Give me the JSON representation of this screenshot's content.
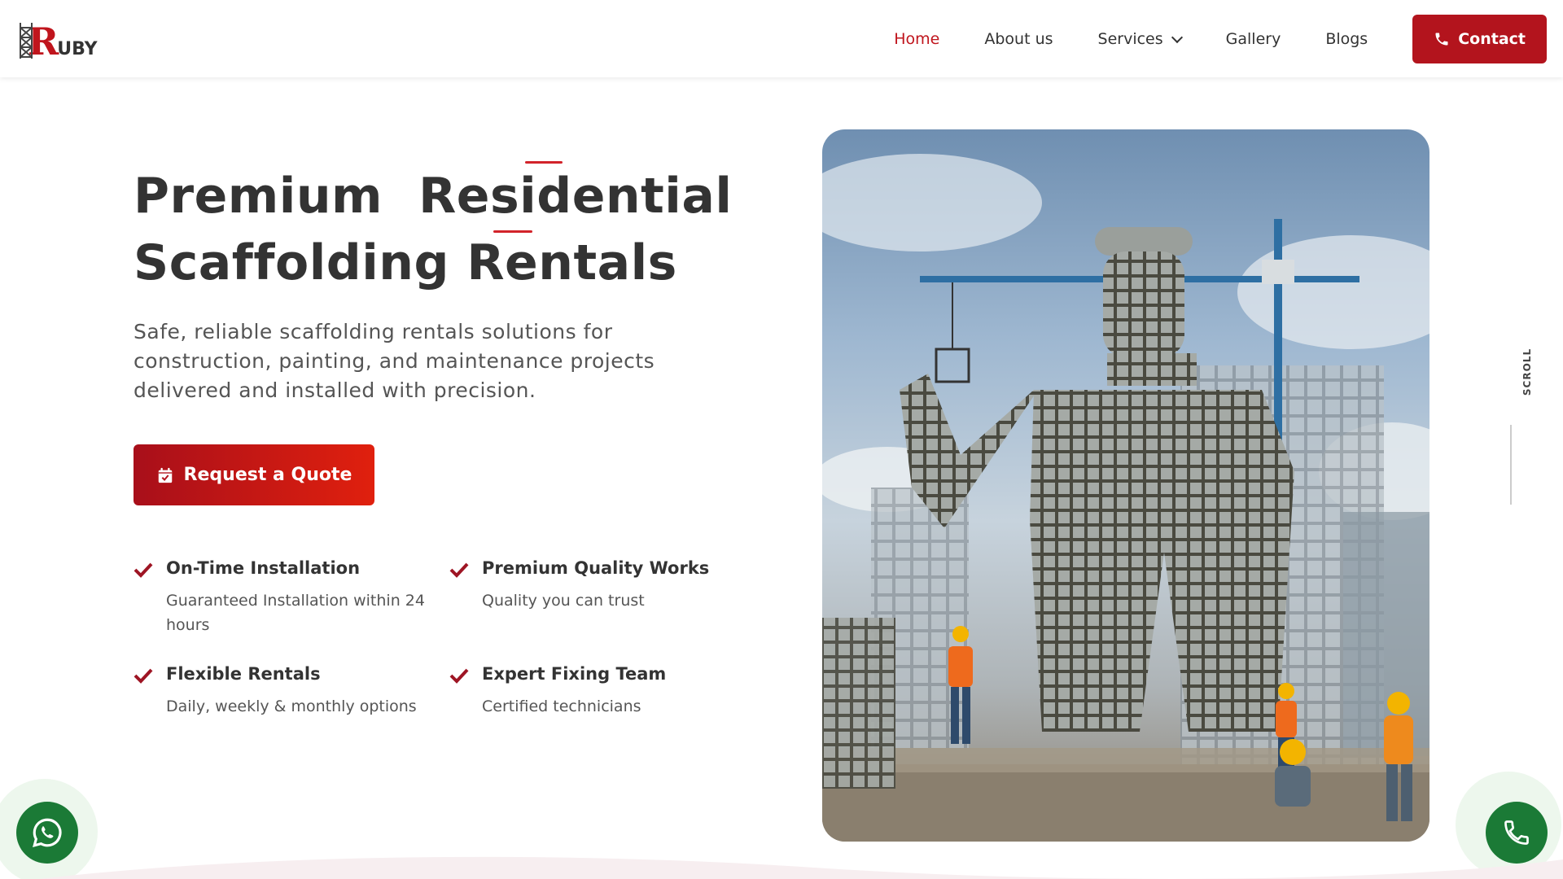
{
  "brand": {
    "logo_text_r": "R",
    "logo_text_rest": "UBY",
    "accent": "#c0151d"
  },
  "nav": {
    "items": [
      {
        "label": "Home",
        "active": true
      },
      {
        "label": "About us"
      },
      {
        "label": "Services",
        "has_dropdown": true
      },
      {
        "label": "Gallery"
      },
      {
        "label": "Blogs"
      }
    ],
    "contact_label": "Contact",
    "contact_icon": "phone-icon"
  },
  "hero": {
    "title_word_1": "Premium",
    "title_word_2": "Residential",
    "title_line_2": "Scaffolding Rentals",
    "subtitle": "Safe, reliable scaffolding rentals solutions for construction, painting, and maintenance projects delivered and installed with precision.",
    "cta_label": "Request a Quote",
    "cta_icon": "calendar-check-icon"
  },
  "features": [
    {
      "title": "On-Time Installation",
      "desc": "Guaranteed Installation within 24 hours"
    },
    {
      "title": "Premium Quality Works",
      "desc": "Quality you can trust"
    },
    {
      "title": "Flexible Rentals",
      "desc": "Daily, weekly & monthly options"
    },
    {
      "title": "Expert Fixing Team",
      "desc": "Certified technicians"
    }
  ],
  "scroll_label": "SCROLL",
  "floating": {
    "whatsapp_icon": "whatsapp-icon",
    "call_icon": "phone-icon"
  },
  "colors": {
    "primary": "#b3141d",
    "whatsapp": "#1b7a36",
    "text": "#333333"
  }
}
